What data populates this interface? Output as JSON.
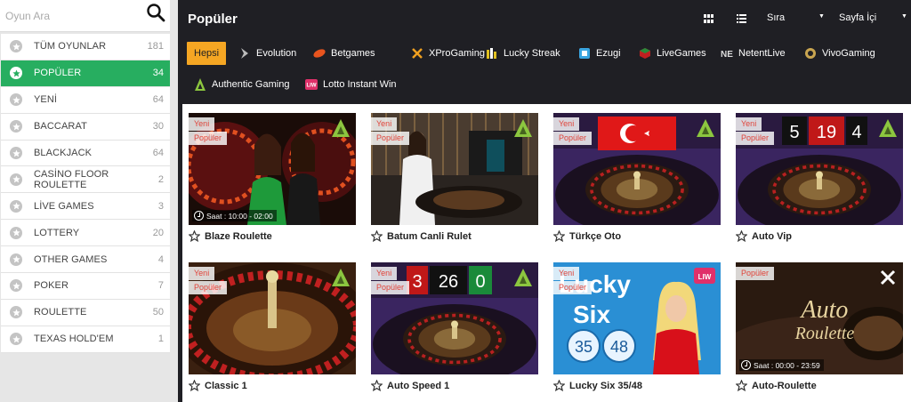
{
  "search": {
    "placeholder": "Oyun Ara"
  },
  "sidebar": {
    "items": [
      {
        "label": "TÜM OYUNLAR",
        "count": "181",
        "active": false
      },
      {
        "label": "POPÜLER",
        "count": "34",
        "active": true
      },
      {
        "label": "YENİ",
        "count": "64",
        "active": false
      },
      {
        "label": "BACCARAT",
        "count": "30",
        "active": false
      },
      {
        "label": "BLACKJACK",
        "count": "64",
        "active": false
      },
      {
        "label": "CASİNO FLOOR ROULETTE",
        "count": "2",
        "active": false
      },
      {
        "label": "LİVE GAMES",
        "count": "3",
        "active": false
      },
      {
        "label": "LOTTERY",
        "count": "20",
        "active": false
      },
      {
        "label": "OTHER GAMES",
        "count": "4",
        "active": false
      },
      {
        "label": "POKER",
        "count": "7",
        "active": false
      },
      {
        "label": "ROULETTE",
        "count": "50",
        "active": false
      },
      {
        "label": "TEXAS HOLD'EM",
        "count": "1",
        "active": false
      }
    ]
  },
  "header": {
    "title": "Popüler",
    "sort_label": "Sıra",
    "page_label": "Sayfa İçi"
  },
  "providers": [
    {
      "label": "Hepsi",
      "icon": "none",
      "active": true
    },
    {
      "label": "Evolution",
      "icon": "evolution-icon",
      "active": false
    },
    {
      "label": "Betgames",
      "icon": "betgames-icon",
      "active": false
    },
    {
      "label": "XProGaming",
      "icon": "xprogaming-icon",
      "active": false
    },
    {
      "label": "Lucky Streak",
      "icon": "luckystreak-icon",
      "active": false
    },
    {
      "label": "Ezugi",
      "icon": "ezugi-icon",
      "active": false
    },
    {
      "label": "LiveGames",
      "icon": "livegames-icon",
      "active": false
    },
    {
      "label": "NetentLive",
      "icon": "netent-icon",
      "active": false
    },
    {
      "label": "VivoGaming",
      "icon": "vivogaming-icon",
      "active": false
    },
    {
      "label": "Authentic Gaming",
      "icon": "authentic-icon",
      "active": false
    },
    {
      "label": "Lotto Instant Win",
      "icon": "lotto-icon",
      "active": false
    }
  ],
  "games": [
    {
      "name": "Blaze Roulette",
      "tags": [
        "Yeni",
        "Popüler"
      ],
      "hours": "Saat : 10:00 - 02:00",
      "theme": "blaze"
    },
    {
      "name": "Batum Canli Rulet",
      "tags": [
        "Yeni",
        "Popüler"
      ],
      "hours": "",
      "theme": "batum"
    },
    {
      "name": "Türkçe Oto",
      "tags": [
        "Yeni",
        "Popüler"
      ],
      "hours": "",
      "theme": "turkce"
    },
    {
      "name": "Auto Vip",
      "tags": [
        "Yeni",
        "Popüler"
      ],
      "hours": "",
      "theme": "vip"
    },
    {
      "name": "Classic 1",
      "tags": [
        "Yeni",
        "Popüler"
      ],
      "hours": "",
      "theme": "classic"
    },
    {
      "name": "Auto Speed 1",
      "tags": [
        "Yeni",
        "Popüler"
      ],
      "hours": "",
      "theme": "speed"
    },
    {
      "name": "Lucky Six 35/48",
      "tags": [
        "Yeni",
        "Popüler"
      ],
      "hours": "",
      "theme": "lucky"
    },
    {
      "name": "Auto-Roulette",
      "tags": [
        "Popüler"
      ],
      "hours": "Saat : 00:00 - 23:59",
      "theme": "auto"
    }
  ],
  "thumb_text": {
    "vip_numbers": [
      "5",
      "19",
      "4"
    ],
    "speed_numbers": [
      "3",
      "26",
      "0"
    ],
    "lucky_word1": "Lucky",
    "lucky_word2": "Six",
    "lucky_b1": "35",
    "lucky_b2": "48",
    "auto_script1": "Auto",
    "auto_script2": "Roulette"
  },
  "colors": {
    "active_green": "#27ae60",
    "active_filter": "#f5a623",
    "main_bg": "#1f1f24",
    "tag_text": "#e0443a"
  }
}
